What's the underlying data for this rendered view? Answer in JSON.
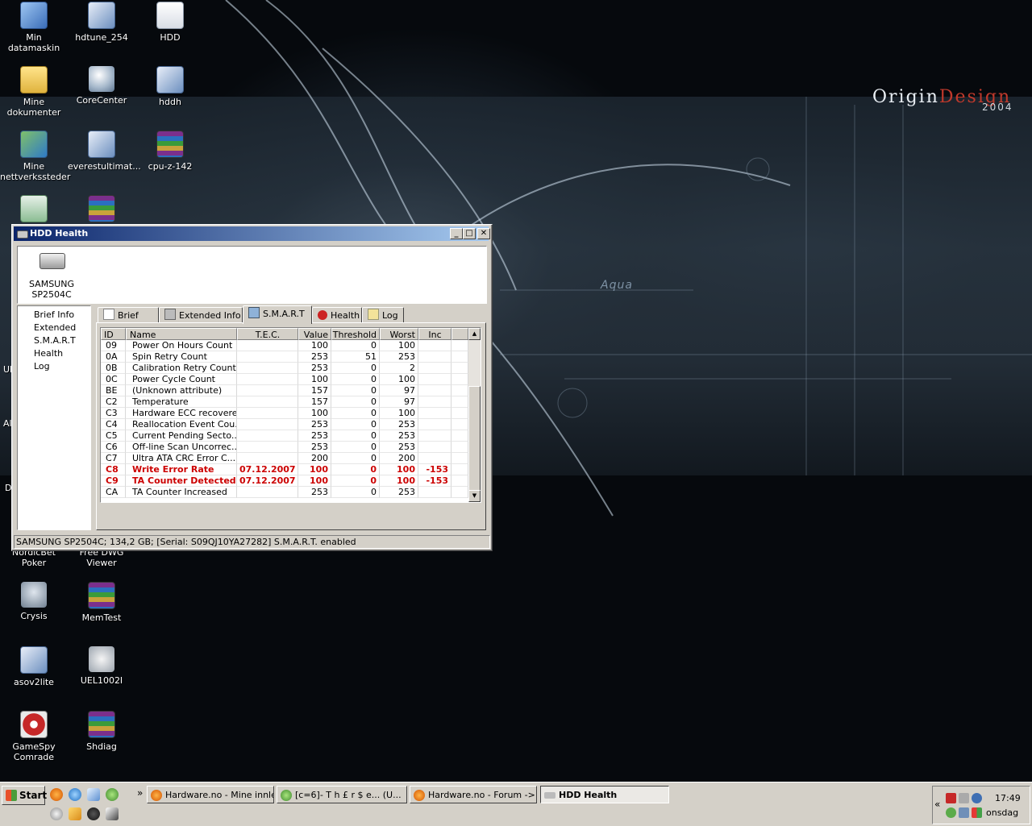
{
  "desktop": {
    "icons": [
      {
        "label": "Min datamaskin"
      },
      {
        "label": "hdtune_254"
      },
      {
        "label": "HDD"
      },
      {
        "label": "Mine dokumenter"
      },
      {
        "label": "CoreCenter"
      },
      {
        "label": "hddh"
      },
      {
        "label": "Mine nettverkssteder"
      },
      {
        "label": "everestultimat..."
      },
      {
        "label": "cpu-z-142"
      },
      {
        "label": "NordicBet Poker"
      },
      {
        "label": "Free DWG Viewer"
      },
      {
        "label": "Crysis"
      },
      {
        "label": "MemTest"
      },
      {
        "label": "asov2lite"
      },
      {
        "label": "UEL1002I"
      },
      {
        "label": "GameSpy Comrade"
      },
      {
        "label": "Shdiag"
      }
    ],
    "partial_labels": [
      "Ul",
      "Al",
      "D"
    ]
  },
  "wallpaper": {
    "logo_a": "Origin",
    "logo_b": "Design",
    "year": "2004",
    "aqua": "Aqua"
  },
  "window": {
    "title": "HDD Health",
    "buttons": {
      "minimize": "_",
      "maximize": "□",
      "close": "✕"
    },
    "drive": {
      "name": "SAMSUNG",
      "model": "SP2504C"
    },
    "nav": [
      "Brief Info",
      "Extended",
      "S.M.A.R.T",
      "Health",
      "Log"
    ],
    "tabs": [
      {
        "label": "Brief Info"
      },
      {
        "label": "Extended Info"
      },
      {
        "label": "S.M.A.R.T"
      },
      {
        "label": "Health"
      },
      {
        "label": "Log"
      }
    ],
    "active_tab": "S.M.A.R.T",
    "columns": [
      "ID",
      "Name",
      "T.E.C.",
      "Value",
      "Threshold",
      "Worst",
      "Inc"
    ],
    "rows": [
      {
        "id": "09",
        "name": "Power On Hours Count",
        "tec": "",
        "value": "100",
        "threshold": "0",
        "worst": "100",
        "inc": ""
      },
      {
        "id": "0A",
        "name": "Spin Retry Count",
        "tec": "",
        "value": "253",
        "threshold": "51",
        "worst": "253",
        "inc": ""
      },
      {
        "id": "0B",
        "name": "Calibration Retry Count",
        "tec": "",
        "value": "253",
        "threshold": "0",
        "worst": "2",
        "inc": ""
      },
      {
        "id": "0C",
        "name": "Power Cycle Count",
        "tec": "",
        "value": "100",
        "threshold": "0",
        "worst": "100",
        "inc": ""
      },
      {
        "id": "BE",
        "name": "(Unknown attribute)",
        "tec": "",
        "value": "157",
        "threshold": "0",
        "worst": "97",
        "inc": ""
      },
      {
        "id": "C2",
        "name": "Temperature",
        "tec": "",
        "value": "157",
        "threshold": "0",
        "worst": "97",
        "inc": ""
      },
      {
        "id": "C3",
        "name": "Hardware ECC recovered",
        "tec": "",
        "value": "100",
        "threshold": "0",
        "worst": "100",
        "inc": ""
      },
      {
        "id": "C4",
        "name": "Reallocation Event Cou...",
        "tec": "",
        "value": "253",
        "threshold": "0",
        "worst": "253",
        "inc": ""
      },
      {
        "id": "C5",
        "name": "Current Pending Secto...",
        "tec": "",
        "value": "253",
        "threshold": "0",
        "worst": "253",
        "inc": ""
      },
      {
        "id": "C6",
        "name": "Off-line Scan Uncorrec...",
        "tec": "",
        "value": "253",
        "threshold": "0",
        "worst": "253",
        "inc": ""
      },
      {
        "id": "C7",
        "name": "Ultra ATA CRC Error C...",
        "tec": "",
        "value": "200",
        "threshold": "0",
        "worst": "200",
        "inc": ""
      },
      {
        "id": "C8",
        "name": "Write Error Rate",
        "tec": "07.12.2007",
        "value": "100",
        "threshold": "0",
        "worst": "100",
        "inc": "-153",
        "alert": true
      },
      {
        "id": "C9",
        "name": "TA Counter Detected",
        "tec": "07.12.2007",
        "value": "100",
        "threshold": "0",
        "worst": "100",
        "inc": "-153",
        "alert": true
      },
      {
        "id": "CA",
        "name": "TA Counter Increased",
        "tec": "",
        "value": "253",
        "threshold": "0",
        "worst": "253",
        "inc": ""
      }
    ],
    "status": "SAMSUNG SP2504C;  134,2 GB;  [Serial: S09QJ10YA27282]   S.M.A.R.T. enabled"
  },
  "taskbar": {
    "start": "Start",
    "chevron": "»",
    "tasks": [
      {
        "label": "Hardware.no - Mine innle..."
      },
      {
        "label": "[c=6]- T h £ r $ e... (U..."
      },
      {
        "label": "Hardware.no - Forum ->..."
      },
      {
        "label": "HDD Health"
      }
    ],
    "tray_chevron": "«",
    "time": "17:49",
    "day": "onsdag"
  },
  "colors": {
    "alert": "#cc0000",
    "title_start": "#0a246a",
    "title_end": "#a6caf0"
  }
}
